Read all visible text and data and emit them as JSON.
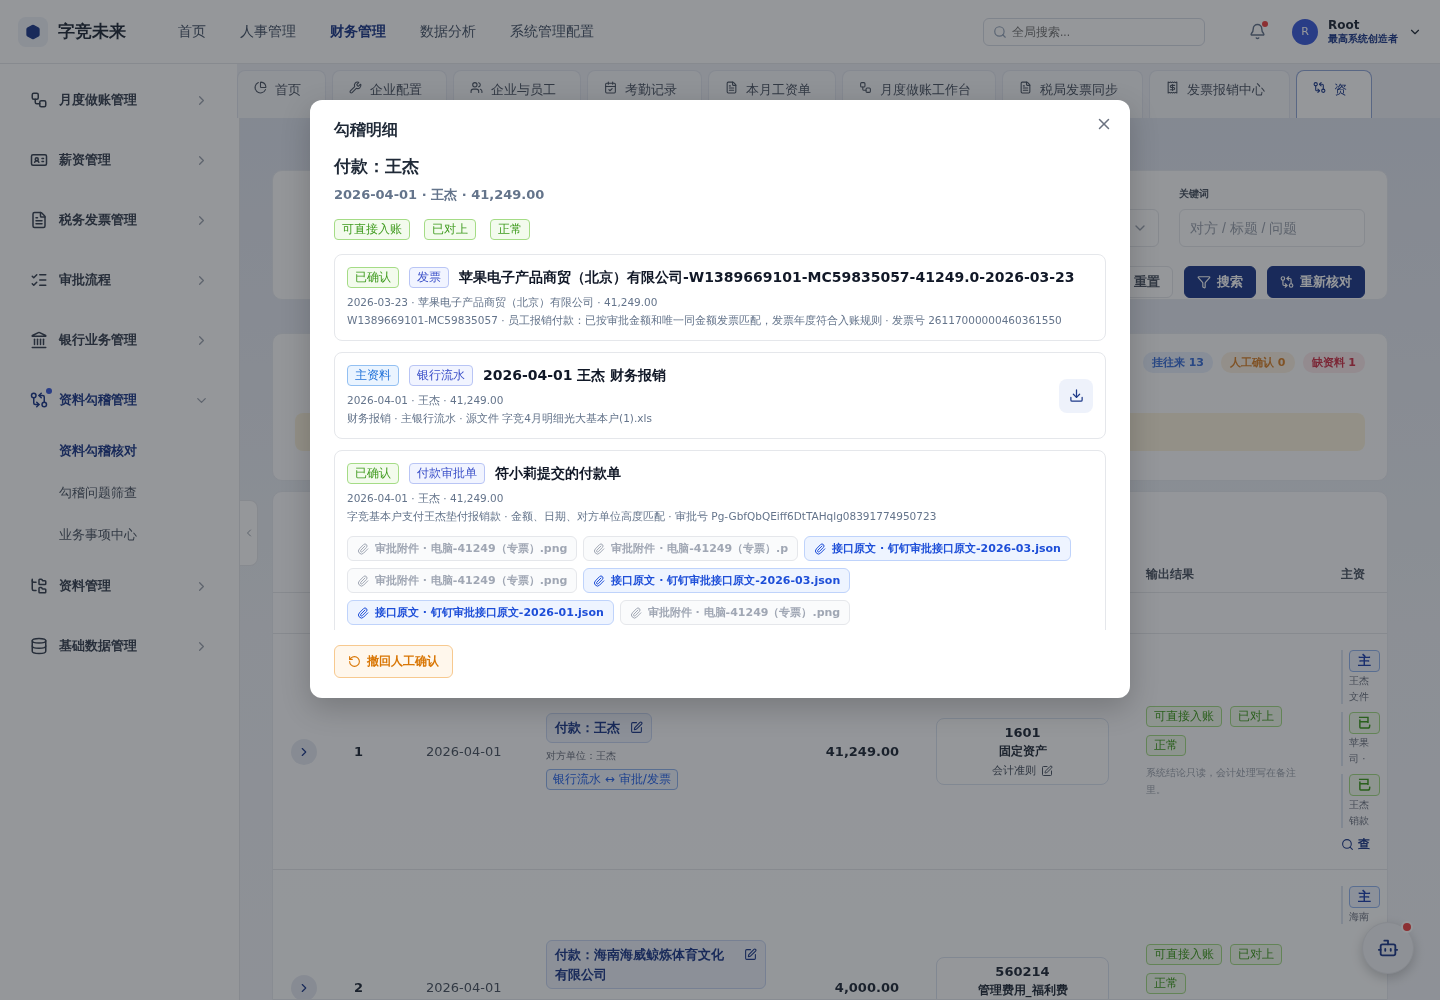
{
  "header": {
    "logo": "字竞未来",
    "nav": [
      {
        "label": "首页",
        "selected": false
      },
      {
        "label": "人事管理",
        "selected": false
      },
      {
        "label": "财务管理",
        "selected": true
      },
      {
        "label": "数据分析",
        "selected": false
      },
      {
        "label": "系统管理配置",
        "selected": false
      }
    ],
    "search": {
      "placeholder": "全局搜索..."
    },
    "user": {
      "avatar": "R",
      "name": "Root",
      "role": "最高系统创造者"
    }
  },
  "sidebar": {
    "items": [
      {
        "label": "月度做账管理",
        "expanded": false
      },
      {
        "label": "薪资管理",
        "expanded": false
      },
      {
        "label": "税务发票管理",
        "expanded": false
      },
      {
        "label": "审批流程",
        "expanded": false
      },
      {
        "label": "银行业务管理",
        "expanded": false
      },
      {
        "label": "资料勾稽管理",
        "expanded": true,
        "children": [
          {
            "label": "资料勾稽核对",
            "selected": true
          },
          {
            "label": "勾稽问题筛查",
            "selected": false
          },
          {
            "label": "业务事项中心",
            "selected": false
          }
        ]
      },
      {
        "label": "资料管理",
        "expanded": false
      },
      {
        "label": "基础数据管理",
        "expanded": false
      }
    ]
  },
  "tabs": [
    {
      "label": "首页",
      "selected": false
    },
    {
      "label": "企业配置",
      "selected": false
    },
    {
      "label": "企业与员工",
      "selected": false
    },
    {
      "label": "考勤记录",
      "selected": false
    },
    {
      "label": "本月工资单",
      "selected": false
    },
    {
      "label": "月度做账工作台",
      "selected": false
    },
    {
      "label": "税局发票同步",
      "selected": false
    },
    {
      "label": "发票报销中心",
      "selected": false
    },
    {
      "label": "资",
      "selected": true
    }
  ],
  "filters": {
    "keyword_label": "关键词",
    "keyword": {
      "placeholder": "对方 / 标题 / 问题"
    },
    "buttons": [
      {
        "kind": "reset",
        "label": "重置"
      },
      {
        "kind": "search",
        "label": "搜索"
      },
      {
        "kind": "recheck",
        "label": "重新核对"
      }
    ]
  },
  "stats": {
    "chips": [
      {
        "label": "挂往来 13",
        "kind": "pending"
      },
      {
        "label": "人工确认 0",
        "kind": "manual"
      },
      {
        "label": "缺资料 1",
        "kind": "missing"
      }
    ]
  },
  "table": {
    "columns": [
      "输出结果",
      "主资"
    ],
    "rows": [
      {
        "index": "1",
        "date": "2026-04-01",
        "title": "付款：王杰",
        "counterparty": "对方单位：王杰",
        "link_tag": "银行流水 ↔ 审批/发票",
        "amount": "41,249.00",
        "subject": {
          "code": "1601",
          "name": "固定资产",
          "rule": "会计准则"
        },
        "tags": [
          "可直接入账",
          "已对上",
          "正常"
        ],
        "note": "系统结论只读，会计处理写在备注里。",
        "main": {
          "groups": [
            {
              "tag": {
                "kind": "main",
                "text": "主"
              },
              "lines": [
                "王杰",
                "文件"
              ]
            },
            {
              "tag": {
                "kind": "ok",
                "text": "已"
              },
              "lines": [
                "苹果",
                "司 ·"
              ]
            },
            {
              "tag": {
                "kind": "ok",
                "text": "已"
              },
              "lines": [
                "王杰",
                "销款"
              ]
            }
          ],
          "link": "查"
        }
      },
      {
        "index": "2",
        "date": "2026-04-01",
        "title": "付款：海南海威鲸炼体育文化有限公司",
        "amount": "4,000.00",
        "subject": {
          "code": "560214",
          "name": "管理费用_福利费"
        },
        "tags": [
          "可直接入账",
          "已对上",
          "正常"
        ],
        "main": {
          "groups": [
            {
              "tag": {
                "kind": "main",
                "text": "主"
              },
              "lines": [
                "海南"
              ]
            }
          ]
        }
      }
    ]
  },
  "modal": {
    "title": "勾稽明细",
    "heading": "付款：王杰",
    "meta": "2026-04-01 · 王杰 · 41,249.00",
    "tags": [
      "可直接入账",
      "已对上",
      "正常"
    ],
    "records": [
      {
        "badges": [
          {
            "kind": "ok",
            "text": "已确认"
          },
          {
            "kind": "type",
            "text": "发票"
          }
        ],
        "title": "苹果电子产品商贸（北京）有限公司-W1389669101-MC59835057-41249.0-2026-03-23",
        "lines": [
          "2026-03-23 · 苹果电子产品商贸（北京）有限公司 · 41,249.00",
          "W1389669101-MC59835057 · 员工报销付款：已按审批金额和唯一同金额发票匹配，发票年度符合入账规则 · 发票号 26117000000460361550"
        ],
        "download": false
      },
      {
        "badges": [
          {
            "kind": "main",
            "text": "主资料"
          },
          {
            "kind": "type",
            "text": "银行流水"
          }
        ],
        "title": "2026-04-01 王杰 财务报销",
        "lines": [
          "2026-04-01 · 王杰 · 41,249.00",
          "财务报销 · 主银行流水 · 源文件 字竞4月明细光大基本户(1).xls"
        ],
        "download": true
      },
      {
        "badges": [
          {
            "kind": "ok",
            "text": "已确认"
          },
          {
            "kind": "type",
            "text": "付款审批单"
          }
        ],
        "title": "符小莉提交的付款单",
        "lines": [
          "2026-04-01 · 王杰 · 41,249.00",
          "字竞基本户支付王杰垫付报销款 · 金额、日期、对方单位高度匹配 · 审批号 Pg-GbfQbQEiff6DtTAHqlg08391774950723"
        ],
        "download": false,
        "attachments": [
          {
            "kind": "file",
            "text": "审批附件 · 电脑-41249（专票）.png"
          },
          {
            "kind": "file",
            "text": "审批附件 · 电脑-41249（专票）.p"
          },
          {
            "kind": "source",
            "text": "接口原文 · 钉钉审批接口原文-2026-03.json"
          },
          {
            "kind": "file",
            "text": "审批附件 · 电脑-41249（专票）.png"
          },
          {
            "kind": "source",
            "text": "接口原文 · 钉钉审批接口原文-2026-03.json"
          },
          {
            "kind": "source",
            "text": "接口原文 · 钉钉审批接口原文-2026-01.json"
          },
          {
            "kind": "file",
            "text": "审批附件 · 电脑-41249（专票）.png"
          }
        ]
      }
    ],
    "footer_button": "撤回人工确认"
  }
}
